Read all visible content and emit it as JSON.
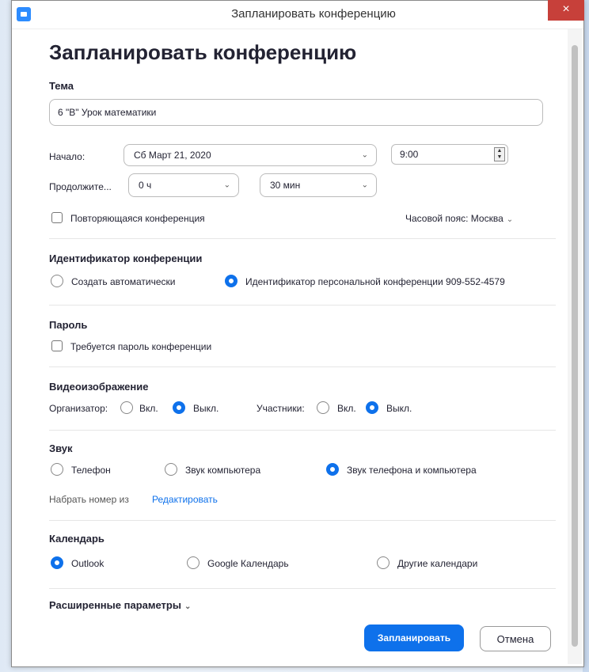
{
  "window": {
    "title": "Запланировать конференцию",
    "close_glyph": "×"
  },
  "heading": "Запланировать конференцию",
  "topic": {
    "label": "Тема",
    "value": "6 \"В\" Урок математики"
  },
  "start": {
    "label": "Начало:",
    "date": "Сб  Март 21, 2020",
    "time": "9:00"
  },
  "duration": {
    "label": "Продолжите...",
    "hours": "0 ч",
    "minutes": "30 мин"
  },
  "recurring": {
    "label": "Повторяющаяся конференция"
  },
  "timezone": {
    "label": "Часовой пояс: Москва"
  },
  "meeting_id": {
    "title": "Идентификатор конференции",
    "auto_label": "Создать автоматически",
    "personal_label": "Идентификатор персональной конференции 909-552-4579",
    "selected": "personal"
  },
  "password": {
    "title": "Пароль",
    "required_label": "Требуется пароль конференции"
  },
  "video": {
    "title": "Видеоизображение",
    "host_label": "Организатор:",
    "participants_label": "Участники:",
    "on_label": "Вкл.",
    "off_label": "Выкл.",
    "host_selected": "off",
    "participants_selected": "off"
  },
  "audio": {
    "title": "Звук",
    "phone_label": "Телефон",
    "computer_label": "Звук компьютера",
    "both_label": "Звук телефона и компьютера",
    "selected": "both",
    "dial_from_label": "Набрать номер из",
    "edit_link": "Редактировать"
  },
  "calendar": {
    "title": "Календарь",
    "outlook_label": "Outlook",
    "google_label": "Google Календарь",
    "other_label": "Другие календари",
    "selected": "outlook"
  },
  "advanced": {
    "label": "Расширенные параметры"
  },
  "actions": {
    "schedule_label": "Запланировать",
    "cancel_label": "Отмена"
  },
  "colors": {
    "accent": "#0e71eb",
    "close_button": "#c7403a",
    "zoom_blue": "#2d8cff"
  },
  "icons": [
    "zoom-app-icon",
    "close-icon",
    "chevron-down-icon",
    "spinner-up-icon",
    "spinner-down-icon"
  ]
}
